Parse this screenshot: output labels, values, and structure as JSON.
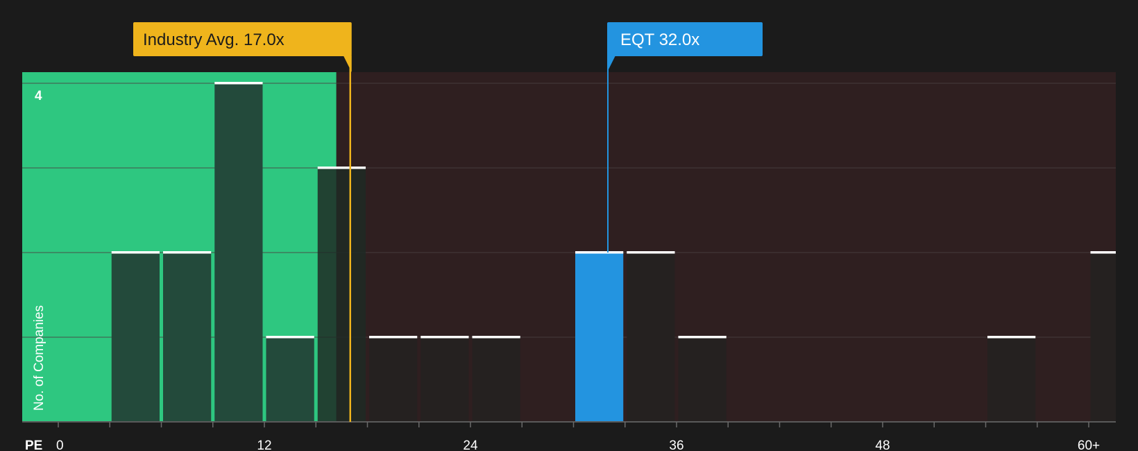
{
  "chart_data": {
    "type": "bar",
    "xlabel": "PE",
    "ylabel": "No. of Companies",
    "x_tick_labels": [
      "0",
      "12",
      "24",
      "36",
      "48",
      "60+"
    ],
    "x_ticks": [
      0,
      12,
      24,
      36,
      48,
      60
    ],
    "xlim": [
      0,
      61.5
    ],
    "ylim": [
      0,
      4.14
    ],
    "y_tick_label": "4",
    "y_tick_value": 4,
    "bin_width": 3,
    "bins": [
      {
        "start": 3,
        "count": 2
      },
      {
        "start": 6,
        "count": 2
      },
      {
        "start": 9,
        "count": 4
      },
      {
        "start": 12,
        "count": 1
      },
      {
        "start": 15,
        "count": 3
      },
      {
        "start": 18,
        "count": 1
      },
      {
        "start": 21,
        "count": 1
      },
      {
        "start": 24,
        "count": 1
      },
      {
        "start": 30,
        "count": 2,
        "highlight": true
      },
      {
        "start": 33,
        "count": 2
      },
      {
        "start": 36,
        "count": 1
      },
      {
        "start": 54,
        "count": 1
      },
      {
        "start": 60,
        "count": 2
      }
    ],
    "industry_avg": {
      "label": "Industry Avg. 17.0x",
      "value": 17.0
    },
    "company": {
      "label": "EQT 32.0x",
      "value": 32.0
    },
    "grid": true,
    "colors": {
      "background": "#1b1b1b",
      "below_avg_region": "#2ec780",
      "above_avg_region": "#2f1f20",
      "bar_below": "#234a3b",
      "bar_above": "#252120",
      "bar_highlight": "#2394e0",
      "bar_cap": "#ffffff",
      "industry_callout": "#efb41c",
      "company_callout": "#2394e0",
      "grid": "#4a4040",
      "tick_text": "#ffffff"
    }
  }
}
